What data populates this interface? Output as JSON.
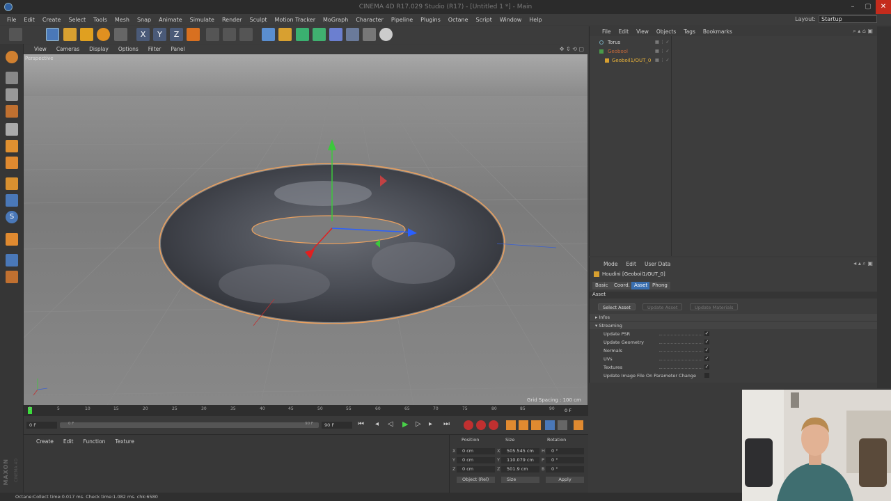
{
  "window": {
    "title": "CINEMA 4D R17.029 Studio (R17) - [Untitled 1 *] - Main"
  },
  "menubar": {
    "items": [
      "File",
      "Edit",
      "Create",
      "Select",
      "Tools",
      "Mesh",
      "Snap",
      "Animate",
      "Simulate",
      "Render",
      "Sculpt",
      "Motion Tracker",
      "MoGraph",
      "Character",
      "Pipeline",
      "Plugins",
      "Octane",
      "Script",
      "Window",
      "Help"
    ],
    "layout_label": "Layout:",
    "layout_value": "Startup"
  },
  "viewport": {
    "menu": [
      "View",
      "Cameras",
      "Display",
      "Options",
      "Filter",
      "Panel"
    ],
    "label": "Perspective",
    "grid_spacing": "Grid Spacing : 100 cm"
  },
  "timeline": {
    "ticks": [
      "0",
      "5",
      "10",
      "15",
      "20",
      "25",
      "30",
      "35",
      "40",
      "45",
      "50",
      "55",
      "60",
      "65",
      "70",
      "75",
      "80",
      "85",
      "90"
    ],
    "current_frame_right": "0 F",
    "start_field": "0 F",
    "end_field": "90 F",
    "range_left": "0 F",
    "range_right": "90 F"
  },
  "material_manager": {
    "menu": [
      "Create",
      "Edit",
      "Function",
      "Texture"
    ]
  },
  "coordinates": {
    "headers": {
      "position": "Position",
      "size": "Size",
      "rotation": "Rotation"
    },
    "rows": [
      {
        "axis": "X",
        "pos": "0 cm",
        "size_axis": "X",
        "size": "505.545 cm",
        "rot_axis": "H",
        "rot": "0 °"
      },
      {
        "axis": "Y",
        "pos": "0 cm",
        "size_axis": "Y",
        "size": "110.079 cm",
        "rot_axis": "P",
        "rot": "0 °"
      },
      {
        "axis": "Z",
        "pos": "0 cm",
        "size_axis": "Z",
        "size": "501.9 cm",
        "rot_axis": "B",
        "rot": "0 °"
      }
    ],
    "mode_select": "Object (Rel)",
    "size_select": "Size",
    "apply_label": "Apply"
  },
  "object_manager": {
    "menu": [
      "File",
      "Edit",
      "View",
      "Objects",
      "Tags",
      "Bookmarks"
    ],
    "objects": [
      {
        "name": "Torus",
        "color": "#d8d8d8"
      },
      {
        "name": "Geobool",
        "color": "#c86a3a"
      },
      {
        "name": "Geoboil1/OUT_0",
        "color": "#e8b23a"
      }
    ]
  },
  "attribute_manager": {
    "menu": [
      "Mode",
      "Edit",
      "User Data"
    ],
    "object_title": "Houdini [Geoboil1/OUT_0]",
    "tabs": [
      "Basic",
      "Coord.",
      "Asset",
      "Phong"
    ],
    "active_tab": "Asset",
    "section": "Asset",
    "buttons": [
      "Select Asset",
      "Update Asset",
      "Update Materials"
    ],
    "groups": {
      "infos": "Infos",
      "streaming": "Streaming"
    },
    "streaming_options": [
      {
        "label": "Update PSR",
        "checked": "✓"
      },
      {
        "label": "Update Geometry",
        "checked": "✓"
      },
      {
        "label": "Normals",
        "checked": "✓"
      },
      {
        "label": "UVs",
        "checked": "✓"
      },
      {
        "label": "Textures",
        "checked": "✓"
      },
      {
        "label": "Update Image File On Parameter Change",
        "checked": ""
      }
    ]
  },
  "statusbar": {
    "text": "Octane:Collect time:0.017 ms. Check time:1.082 ms. chk:6580"
  },
  "brand": {
    "maxon": "MAXON",
    "product": "CINEMA 4D"
  },
  "colors": {
    "selection_outline": "#e8a060",
    "accent_blue": "#3a6fb0",
    "close_red": "#c42b1c"
  }
}
